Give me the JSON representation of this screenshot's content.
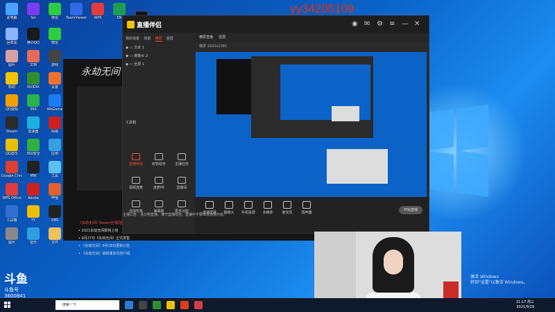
{
  "watermark": "yy34205109",
  "desktop_icons": [
    {
      "label": "此电脑",
      "color": "#4aa3ff"
    },
    {
      "label": "Soi",
      "color": "#7a3cf0"
    },
    {
      "label": "微信",
      "color": "#2ecc40"
    },
    {
      "label": "TeamViewer",
      "color": "#2d6ce5"
    },
    {
      "label": "WPS",
      "color": "#e23c3c"
    },
    {
      "label": "EN",
      "color": "#1f9d55"
    },
    {
      "label": "回收站",
      "color": "#8ab4ff"
    },
    {
      "label": "腾讯QQ",
      "color": "#1a1a1a"
    },
    {
      "label": "微信",
      "color": "#2ecc40"
    },
    {
      "label": "图片",
      "color": "#d8a0a0"
    },
    {
      "label": "文档",
      "color": "#e86a5a"
    },
    {
      "label": "游戏",
      "color": "#444"
    },
    {
      "label": "帮助",
      "color": "#f2c300"
    },
    {
      "label": "NVIDIA",
      "color": "#2f8f2f"
    },
    {
      "label": "设置",
      "color": "#f07030"
    },
    {
      "label": "QQ游戏",
      "color": "#f2a000"
    },
    {
      "label": "360",
      "color": "#29b34a"
    },
    {
      "label": "WeGame",
      "color": "#1b7df0"
    },
    {
      "label": "Steam",
      "color": "#2b2b2b"
    },
    {
      "label": "加速器",
      "color": "#1bb0e0"
    },
    {
      "label": "网易",
      "color": "#cc2020"
    },
    {
      "label": "QQ音乐",
      "color": "#e8c000"
    },
    {
      "label": "360安全",
      "color": "#30b040"
    },
    {
      "label": "应用",
      "color": "#36a0e0"
    },
    {
      "label": "Google Chrome",
      "color": "#e04030"
    },
    {
      "label": "MW",
      "color": "#222"
    },
    {
      "label": "工具",
      "color": "#5cc0f0"
    },
    {
      "label": "WPS Office",
      "color": "#e23c3c"
    },
    {
      "label": "Adobe",
      "color": "#d02020"
    },
    {
      "label": "哔哩",
      "color": "#e06030"
    },
    {
      "label": "工具箱",
      "color": "#3070d0"
    },
    {
      "label": "YY",
      "color": "#f0c000"
    },
    {
      "label": "OBS",
      "color": "#222"
    },
    {
      "label": "图片",
      "color": "#888"
    },
    {
      "label": "音乐",
      "color": "#2ea0e0"
    },
    {
      "label": "文件",
      "color": "#f0c060"
    }
  ],
  "doc_window": {
    "title": "永劫无间",
    "lines": [
      "《永劫无间》Steam全球同服",
      "• 2021永劫无间即将上线",
      "• 9月27日《永劫无间》正式发售",
      "• 《永劫无间》9月28日更新公告",
      "• 《永劫无间》最新版本内容介绍"
    ]
  },
  "app": {
    "title": "直播伴侣",
    "tabs": [
      "我的场景",
      "场景",
      "横屏",
      "竖屏"
    ],
    "active_tab": "横屏",
    "scenes": [
      "文本 1",
      "摄像头 2",
      "全屏 1"
    ],
    "tools_label": "工具箱",
    "tools": [
      {
        "label": "直播伴侣",
        "icon": "live-icon"
      },
      {
        "label": "房管助手",
        "icon": "user-icon"
      },
      {
        "label": "主播任务",
        "icon": "task-icon"
      },
      {
        "label": "视频连麦",
        "icon": "video-icon"
      },
      {
        "label": "连麦PK",
        "icon": "pk-icon"
      },
      {
        "label": "直播间",
        "icon": "room-icon"
      },
      {
        "label": "虚拟形象",
        "icon": "avatar-icon"
      },
      {
        "label": "弹幕姬",
        "icon": "danmaku-icon"
      },
      {
        "label": "更多功能",
        "icon": "more-icon"
      }
    ],
    "preview_tabs": [
      "横屏直播",
      "竖屏"
    ],
    "preview_status": "横屏  1920x1080",
    "bottom_buttons": [
      {
        "label": "直播屏幕",
        "icon": "screen-icon"
      },
      {
        "label": "摄像头",
        "icon": "camera-icon"
      },
      {
        "label": "手机投屏",
        "icon": "phone-icon"
      },
      {
        "label": "多媒体",
        "icon": "media-icon"
      },
      {
        "label": "麦克风",
        "icon": "mic-icon"
      },
      {
        "label": "扬声器",
        "icon": "speaker-icon"
      }
    ],
    "golive": "开始直播",
    "ticker": "主播公告：请文明直播，遵守直播规范。直播中不要出现违规内容。"
  },
  "douyu": {
    "name": "斗鱼",
    "sub": "斗鱼号",
    "id": "3600841"
  },
  "activate": {
    "line1": "激活 Windows",
    "line2": "转到\"设置\"以激活 Windows。"
  },
  "taskbar": {
    "search": "搜索一下",
    "time": "21:17 周三",
    "date": "2021/9/29"
  }
}
